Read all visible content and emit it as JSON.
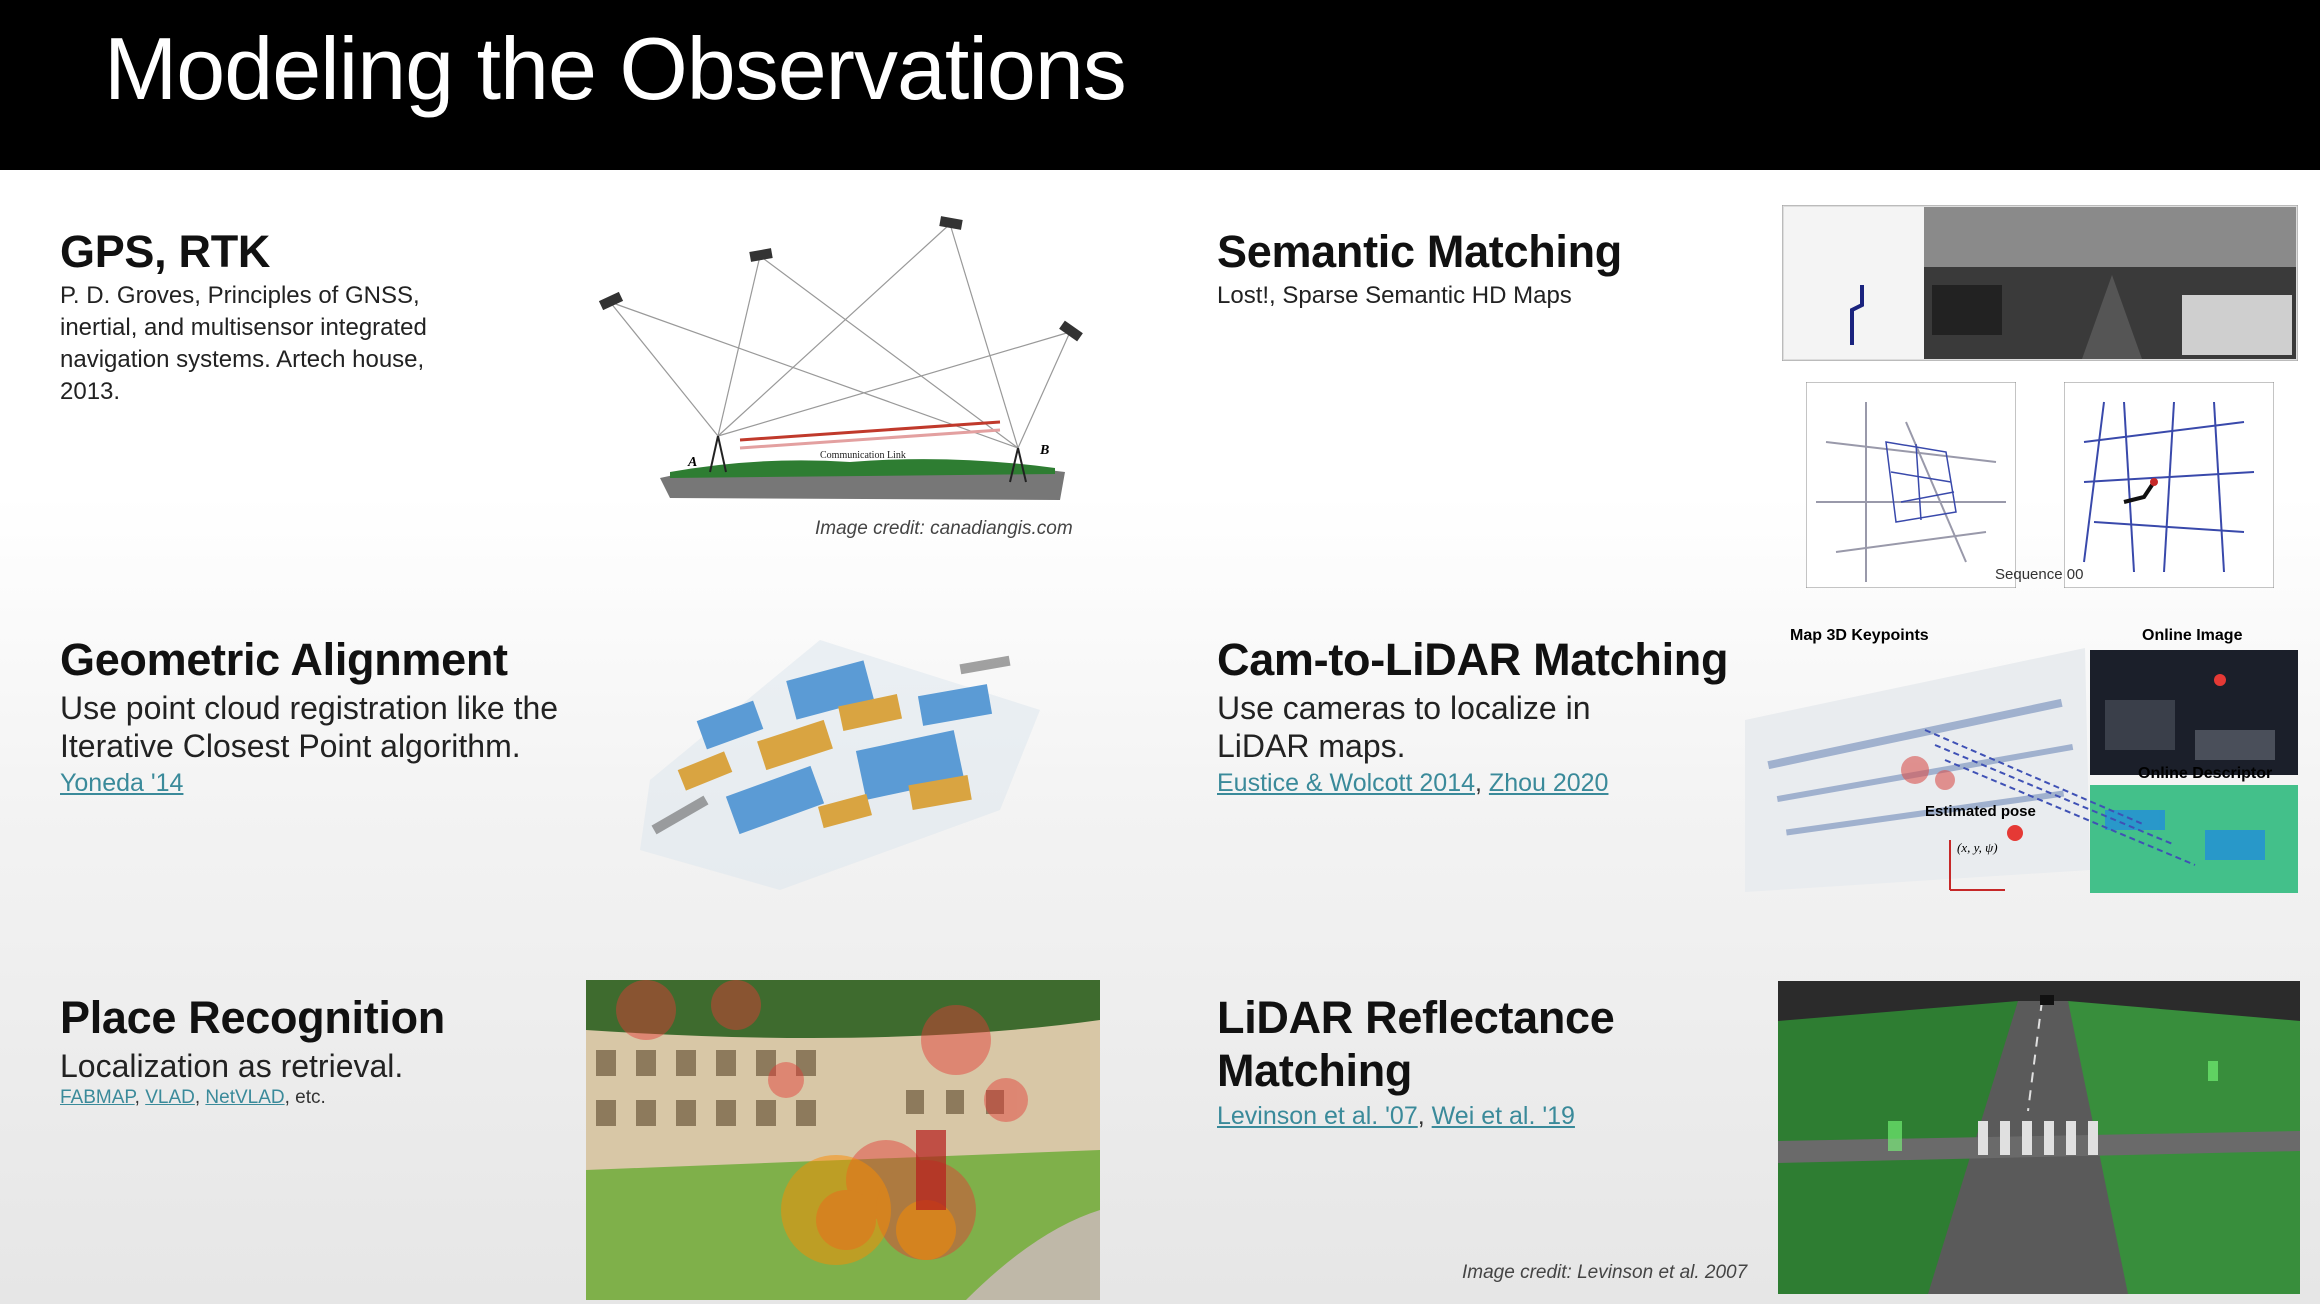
{
  "slide": {
    "title": "Modeling the Observations"
  },
  "sections": {
    "gps": {
      "heading": "GPS, RTK",
      "body": "P. D. Groves, Principles of GNSS, inertial, and multisensor integrated navigation systems. Artech house, 2013.",
      "image_credit": "Image credit: canadiangis.com",
      "diagram_labels": {
        "a": "A",
        "b": "B",
        "link": "Communication Link"
      }
    },
    "semantic": {
      "heading": "Semantic Matching",
      "body": "Lost!, Sparse Semantic HD Maps",
      "sequence_label": "Sequence 00"
    },
    "geometric": {
      "heading": "Geometric Alignment",
      "body_line1": "Use point cloud registration like the",
      "body_line2": "Iterative Closest Point algorithm.",
      "link": "Yoneda '14"
    },
    "camlidar": {
      "heading": "Cam-to-LiDAR Matching",
      "body_line1": "Use cameras to localize in",
      "body_line2": "LiDAR maps.",
      "link1": "Eustice & Wolcott 2014",
      "sep": ", ",
      "link2": "Zhou 2020",
      "fig_labels": {
        "map": "Map 3D Keypoints",
        "online_image": "Online  Image",
        "online_desc": "Online Descriptor",
        "pose": "Estimated pose",
        "pose_vars": "(x, y, ψ)"
      }
    },
    "place": {
      "heading": "Place Recognition",
      "body": "Localization as retrieval.",
      "link1": "FABMAP",
      "link2": "VLAD",
      "link3": "NetVLAD",
      "sep": ", ",
      "tail": ", etc."
    },
    "reflectance": {
      "heading_line1": "LiDAR Reflectance",
      "heading_line2": "Matching",
      "link1": "Levinson et al. '07",
      "sep": ", ",
      "link2": "Wei et al. '19",
      "image_credit": "Image credit: Levinson et al.  2007"
    }
  }
}
